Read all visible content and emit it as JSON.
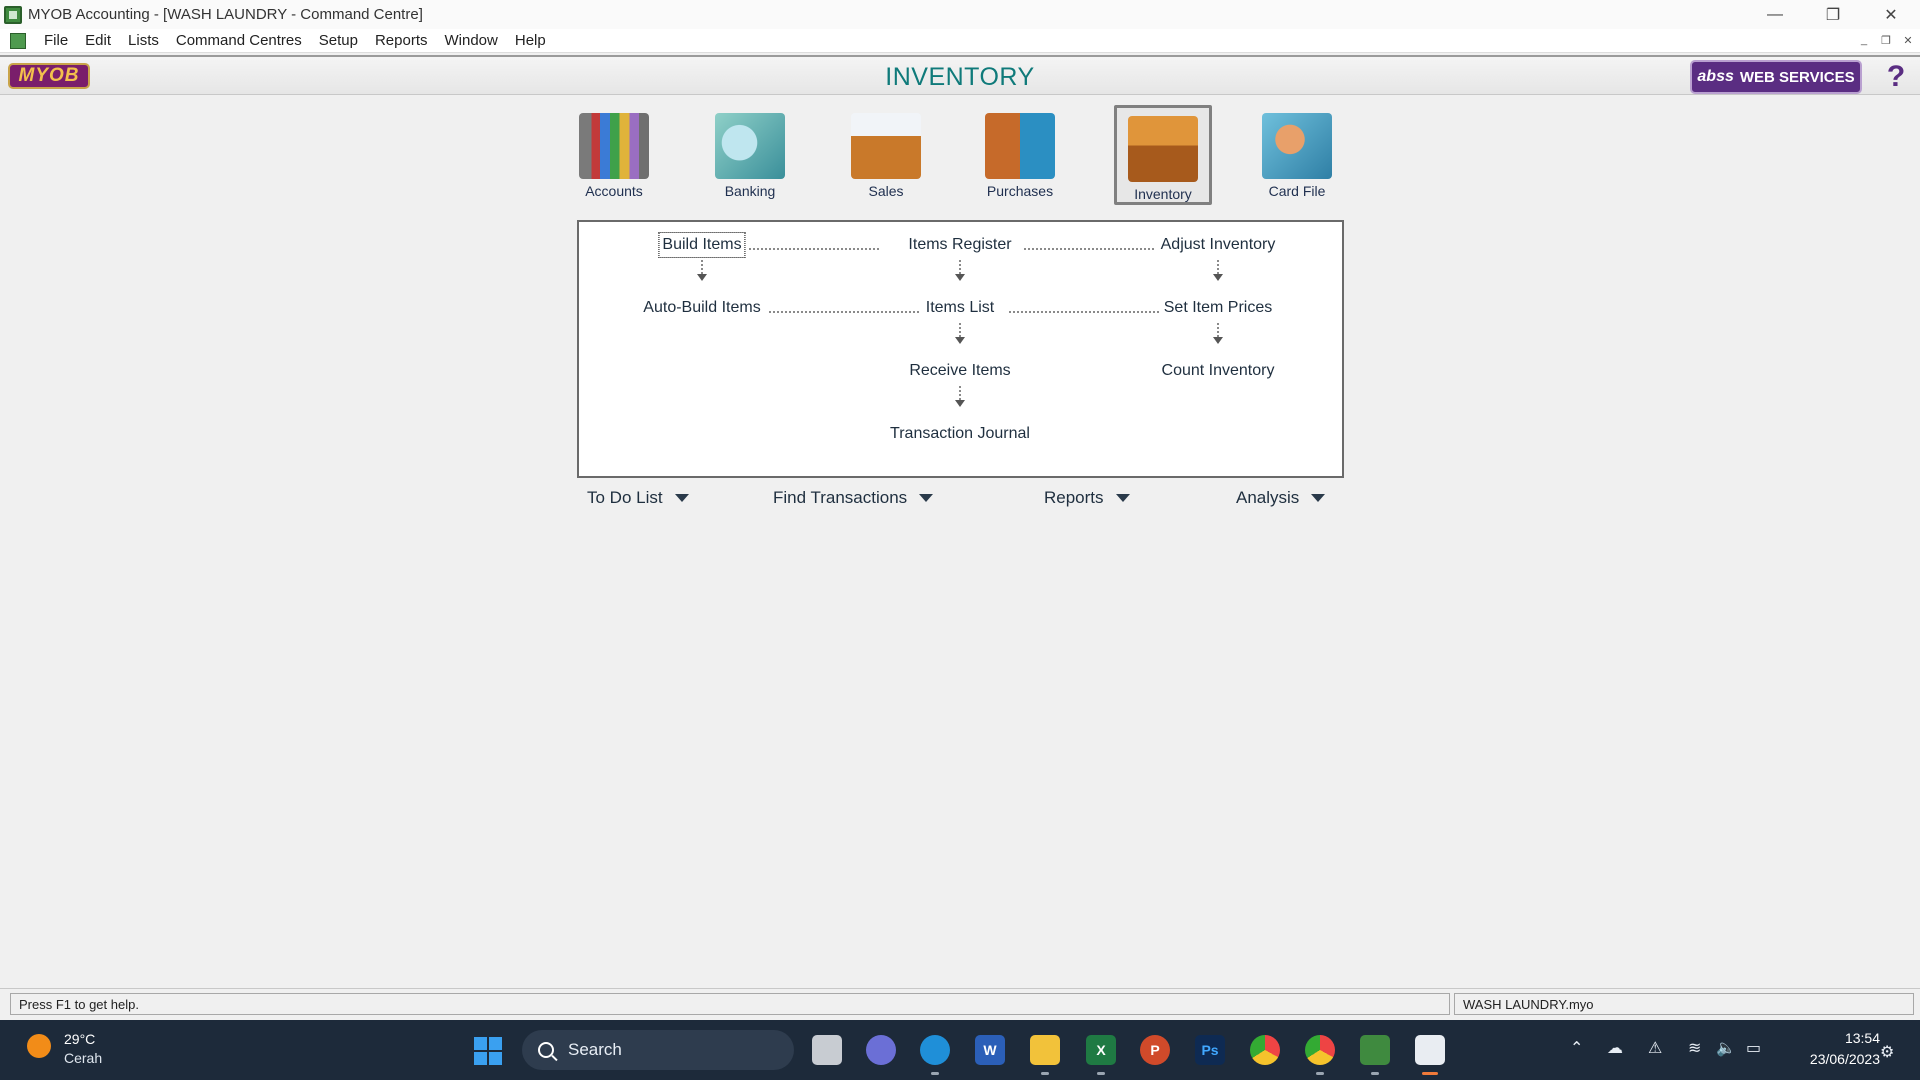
{
  "window": {
    "title": "MYOB Accounting - [WASH LAUNDRY - Command Centre]",
    "controls": {
      "minimize": "—",
      "restore": "❐",
      "close": "✕"
    }
  },
  "menu": [
    "File",
    "Edit",
    "Lists",
    "Command Centres",
    "Setup",
    "Reports",
    "Window",
    "Help"
  ],
  "header": {
    "logo": "MYOB",
    "title": "INVENTORY",
    "services_brand": "abss",
    "services_label": "WEB SERVICES",
    "help_glyph": "?"
  },
  "command_centres": [
    {
      "label": "Accounts",
      "icon": "accounts-icon"
    },
    {
      "label": "Banking",
      "icon": "banking-icon"
    },
    {
      "label": "Sales",
      "icon": "sales-icon"
    },
    {
      "label": "Purchases",
      "icon": "purchases-icon"
    },
    {
      "label": "Inventory",
      "icon": "inventory-icon",
      "selected": true
    },
    {
      "label": "Card File",
      "icon": "card-file-icon"
    }
  ],
  "flow": {
    "build_items": "Build Items",
    "items_register": "Items Register",
    "adjust_inventory": "Adjust Inventory",
    "auto_build_items": "Auto-Build Items",
    "items_list": "Items List",
    "set_item_prices": "Set Item Prices",
    "receive_items": "Receive Items",
    "count_inventory": "Count Inventory",
    "transaction_journal": "Transaction Journal"
  },
  "dropdowns": [
    "To Do List",
    "Find Transactions",
    "Reports",
    "Analysis"
  ],
  "status": {
    "help": "Press F1 to get help.",
    "file": "WASH LAUNDRY.myo"
  },
  "taskbar": {
    "weather_temp": "29°C",
    "weather_desc": "Cerah",
    "search": "Search",
    "time": "13:54",
    "date": "23/06/2023"
  }
}
